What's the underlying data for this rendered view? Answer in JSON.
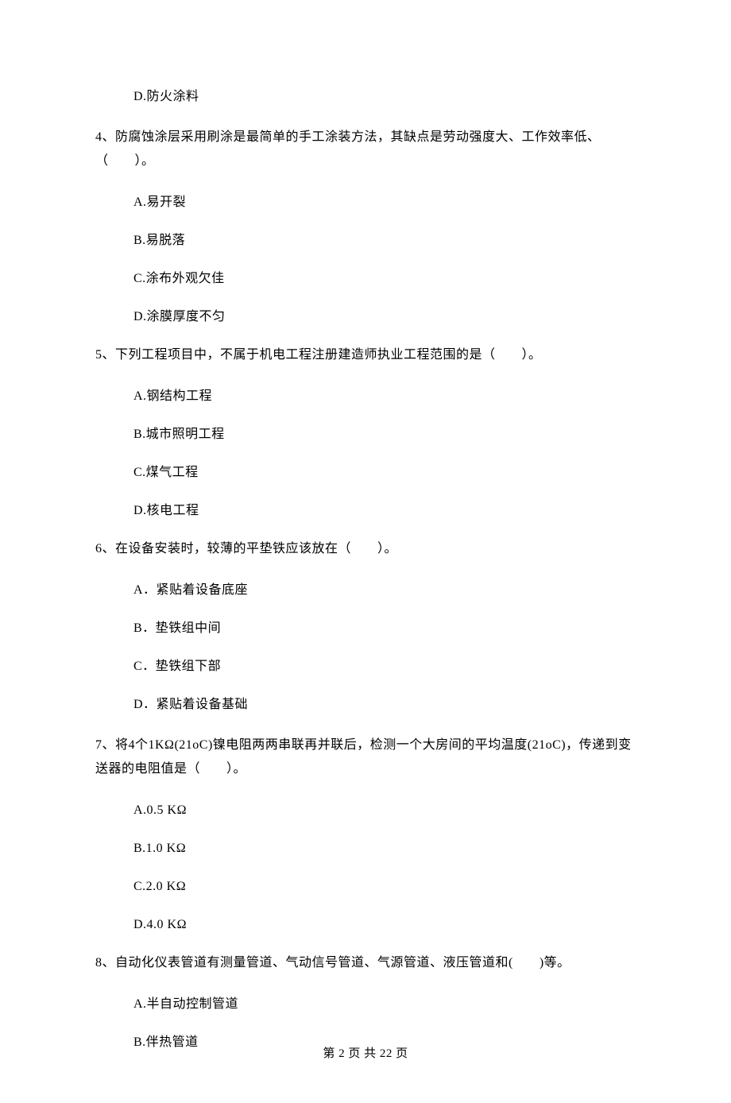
{
  "q3": {
    "options": {
      "d": "D.防火涂料"
    }
  },
  "q4": {
    "text": "4、防腐蚀涂层采用刷涂是最简单的手工涂装方法，其缺点是劳动强度大、工作效率低、（　　）。",
    "options": {
      "a": "A.易开裂",
      "b": "B.易脱落",
      "c": "C.涂布外观欠佳",
      "d": "D.涂膜厚度不匀"
    }
  },
  "q5": {
    "text": "5、下列工程项目中，不属于机电工程注册建造师执业工程范围的是（　　）。",
    "options": {
      "a": "A.钢结构工程",
      "b": "B.城市照明工程",
      "c": "C.煤气工程",
      "d": "D.核电工程"
    }
  },
  "q6": {
    "text": "6、在设备安装时，较薄的平垫铁应该放在（　　）。",
    "options": {
      "a": "A．紧贴着设备底座",
      "b": "B．垫铁组中间",
      "c": "C．垫铁组下部",
      "d": "D．紧贴着设备基础"
    }
  },
  "q7": {
    "text": "7、将4个1KΩ(21oC)镍电阻两两串联再并联后，检测一个大房间的平均温度(21oC)，传递到变送器的电阻值是（　　）。",
    "options": {
      "a": "A.0.5 KΩ",
      "b": "B.1.0 KΩ",
      "c": "C.2.0 KΩ",
      "d": "D.4.0 KΩ"
    }
  },
  "q8": {
    "text": "8、自动化仪表管道有测量管道、气动信号管道、气源管道、液压管道和(　　)等。",
    "options": {
      "a": "A.半自动控制管道",
      "b": "B.伴热管道"
    }
  },
  "footer": "第 2 页 共 22 页"
}
